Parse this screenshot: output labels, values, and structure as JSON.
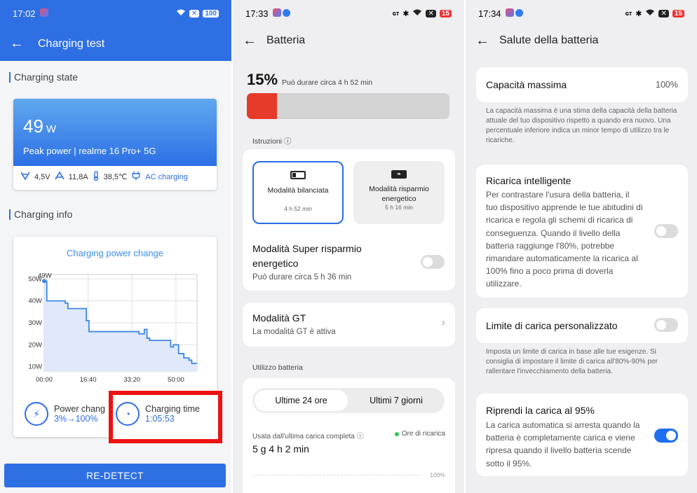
{
  "panel1": {
    "status": {
      "time": "17:02",
      "battery": "100"
    },
    "title": "Charging test",
    "charging_state_label": "Charging state",
    "power": {
      "value": "49",
      "unit": "W",
      "peak_label": "Peak power",
      "device": "realme 16 Pro+ 5G"
    },
    "stats": {
      "voltage": "4,5V",
      "current": "11,8A",
      "temperature": "38,5℃",
      "charger": "AC charging"
    },
    "charging_info_label": "Charging info",
    "chart": {
      "title": "Charging power change",
      "annotation": "49W"
    },
    "power_change": {
      "label": "Power chang",
      "value": "3%→100%"
    },
    "charging_time": {
      "label": "Charging time",
      "value": "1:05:53"
    },
    "redetect": "RE-DETECT"
  },
  "chart_data": {
    "type": "line",
    "title": "Charging power change",
    "xlabel": "",
    "ylabel": "",
    "x_ticks": [
      "00:00",
      "16:40",
      "33:20",
      "50:00"
    ],
    "y_ticks": [
      "10W",
      "20W",
      "30W",
      "40W",
      "50W"
    ],
    "ylim": [
      8,
      52
    ],
    "x_minutes": [
      0,
      1,
      8,
      9,
      16,
      17,
      36,
      37,
      38,
      39,
      40,
      41,
      48,
      49,
      51,
      53,
      55,
      56,
      58
    ],
    "values": [
      49,
      40,
      39,
      36.5,
      31,
      26,
      25,
      25,
      27,
      23,
      22,
      22,
      19,
      20,
      16,
      14,
      13,
      11.5,
      11.5
    ],
    "annotations": [
      "49W"
    ],
    "grid": true
  },
  "panel2": {
    "status": {
      "time": "17:33",
      "battery": "15"
    },
    "title": "Batteria",
    "percent": "15%",
    "duration": "Può durare circa 4 h 52 min",
    "level": 0.15,
    "instructions": "Istruzioni",
    "mode_balanced": {
      "label": "Modalità bilanciata",
      "time": "4 h 52 min"
    },
    "mode_saver": {
      "label": "Modalità risparmio energetico",
      "time": "5 h 16 min"
    },
    "super_saver": {
      "title": "Modalità Super risparmio energetico",
      "sub": "Può durare circa 5 h 36 min"
    },
    "gt": {
      "title": "Modalità GT",
      "sub": "La modalità GT è attiva"
    },
    "usage_label": "Utilizzo batteria",
    "tab_24": "Ultime 24 ore",
    "tab_7": "Ultimi 7 giorni",
    "used_label": "Usata dall'ultima carica completa",
    "recharge_label": "Ore di ricarica",
    "used_value": "5 g 4 h 2 min",
    "axis_100": "100%"
  },
  "panel3": {
    "status": {
      "time": "17:34",
      "battery": "15"
    },
    "title": "Salute della batteria",
    "capacity": {
      "label": "Capacità massima",
      "value": "100%"
    },
    "capacity_desc": "La capacità massima è una stima della capacità della batteria attuale del tuo dispositivo rispetto a quando era nuovo. Una percentuale inferiore indica un minor tempo di utilizzo tra le ricariche.",
    "smart": {
      "title": "Ricarica intelligente",
      "desc": "Per contrastare l'usura della batteria, il tuo dispositivo apprende le tue abitudini di ricarica e regola gli schemi di ricarica di conseguenza. Quando il livello della batteria raggiunge l'80%, potrebbe rimandare automaticamente la ricarica al 100% fino a poco prima di doverla utilizzare."
    },
    "limit": {
      "title": "Limite di carica personalizzato"
    },
    "limit_desc": "Imposta un limite di carica in base alle tue esigenze. Si consiglia di impostare il limite di carica all'80%-90% per rallentare l'invecchiamento della batteria.",
    "resume": {
      "title": "Riprendi la carica al 95%",
      "desc": "La carica automatica si arresta quando la batteria è completamente carica e viene ripresa quando il livello batteria scende sotto il 95%."
    }
  }
}
